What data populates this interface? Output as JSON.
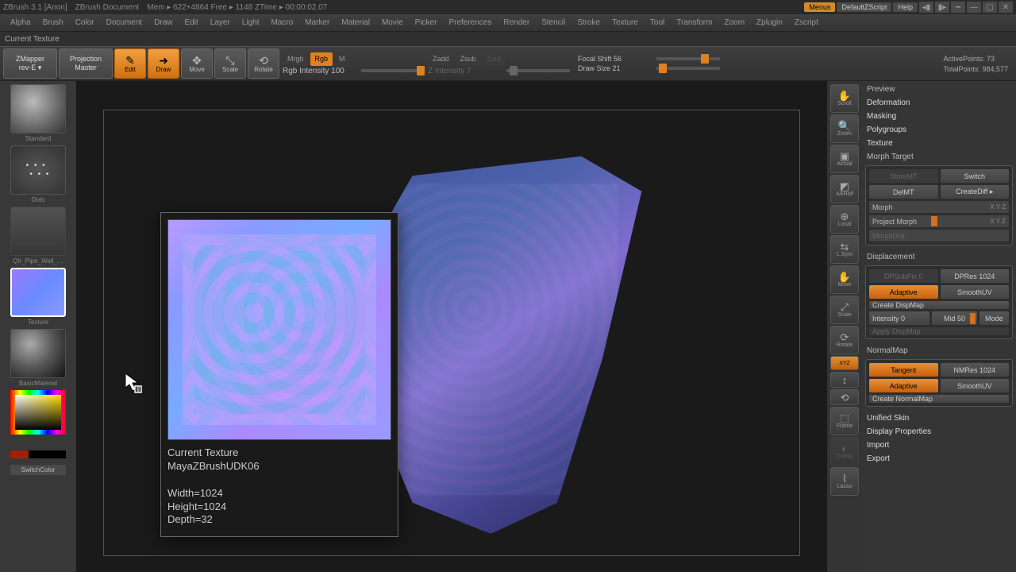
{
  "title": {
    "app": "ZBrush 3.1 [Anon]",
    "doc": "ZBrush Document",
    "mem": "Mem ▸ 622+4864  Free ▸ 1148  ZTime ▸ 00:00:02.07",
    "menus": "Menus",
    "script": "DefaultZScript",
    "help": "Help"
  },
  "menu": [
    "Alpha",
    "Brush",
    "Color",
    "Document",
    "Draw",
    "Edit",
    "Layer",
    "Light",
    "Macro",
    "Marker",
    "Material",
    "Movie",
    "Picker",
    "Preferences",
    "Render",
    "Stencil",
    "Stroke",
    "Texture",
    "Tool",
    "Transform",
    "Zoom",
    "Zplugin",
    "Zscript"
  ],
  "status_line": "Current Texture",
  "toolbar": {
    "zmapper": "ZMapper",
    "zmapper_sub": "rev-E ▾",
    "projection": "Projection",
    "projection_sub": "Master",
    "edit": "Edit",
    "draw": "Draw",
    "move": "Move",
    "scale": "Scale",
    "rotate": "Rotate",
    "mrgb": "Mrgb",
    "rgb": "Rgb",
    "m": "M",
    "rgb_int": "Rgb Intensity 100",
    "zadd": "Zadd",
    "zsub": "Zsub",
    "zcut": "Zcut",
    "z_int": "Z Intensity 7",
    "focal": "Focal Shift 56",
    "draw_size": "Draw Size 21",
    "active_pts": "ActivePoints: 73",
    "total_pts": "TotalPoints: 984,577"
  },
  "left": {
    "standard": "Standard",
    "dots": "Dots",
    "pipe": "Qtr_Pipe_Wall_…",
    "texture": "Texture",
    "material": "BasicMaterial",
    "switch": "SwitchColor"
  },
  "vp": {
    "scroll": "Scroll",
    "zoom": "Zoom",
    "actual": "Actual",
    "aahalf": "AAHalf",
    "local": "Local",
    "lsym": "L.Sym",
    "move": "Move",
    "scale": "Scale",
    "rotate": "Rotate",
    "xyz": "XYZ",
    "frame": "Frame",
    "transp": "Transp",
    "lasso": "Lasso"
  },
  "right": {
    "preview": "Preview",
    "deformation": "Deformation",
    "masking": "Masking",
    "polygroups": "Polygroups",
    "texture": "Texture",
    "morph_target": "Morph Target",
    "storemt": "StoreMT",
    "switch": "Switch",
    "delmt": "DelMT",
    "creatediff": "CreateDiff ▸",
    "morph": "Morph",
    "xyz1": "X Y Z",
    "project_morph": "Project Morph",
    "xyz2": "X Y Z",
    "morphdist": "MorphDist",
    "displacement": "Displacement",
    "dpsubpix": "DPSubPix 0",
    "dpres": "DPRes 1024",
    "adaptive": "Adaptive",
    "smoothuv": "SmoothUV",
    "create_disp": "Create DispMap",
    "intensity": "Intensity 0",
    "mid": "Mid 50",
    "mode": "Mode",
    "apply_disp": "Apply DispMap",
    "normalmap": "NormalMap",
    "tangent": "Tangent",
    "nmres": "NMRes 1024",
    "create_nm": "Create NormalMap",
    "unified": "Unified Skin",
    "display_props": "Display Properties",
    "import": "Import",
    "export": "Export"
  },
  "tooltip": {
    "title": "Current Texture",
    "name": "MayaZBrushUDK06",
    "width": "Width=1024",
    "height": "Height=1024",
    "depth": "Depth=32"
  }
}
